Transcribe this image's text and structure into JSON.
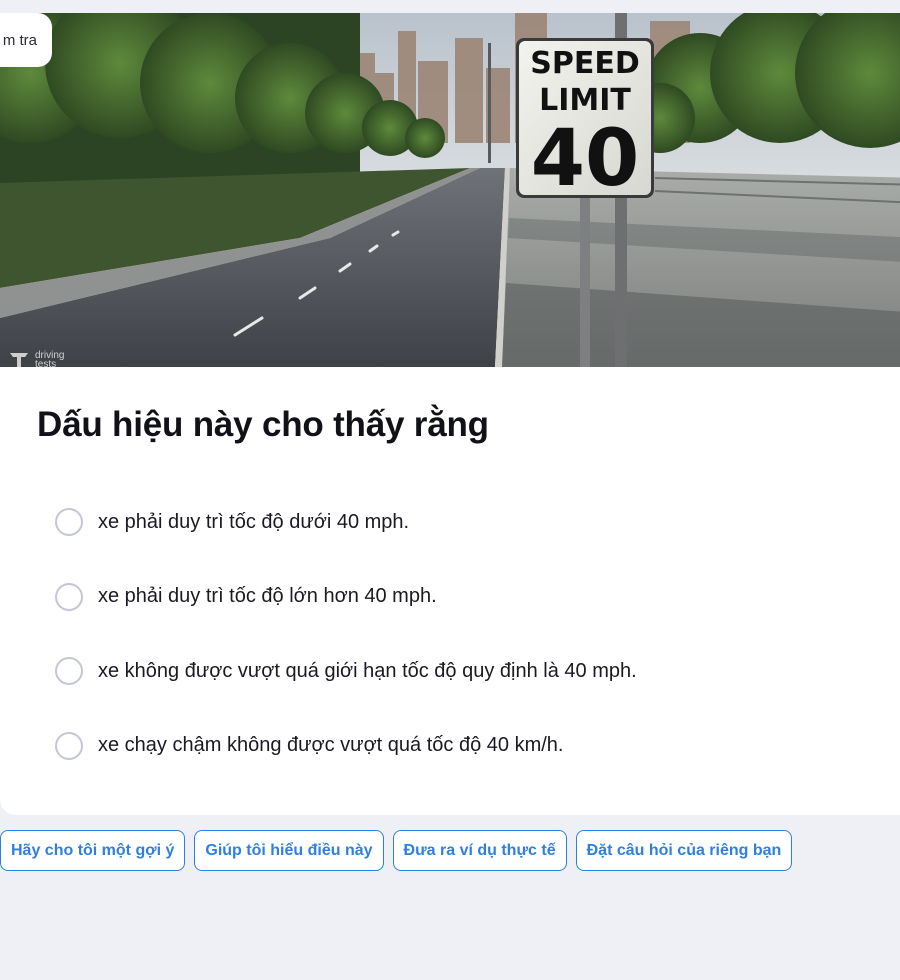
{
  "back_chip": {
    "label": "m tra"
  },
  "photo": {
    "description_icon": "speed-limit-road-photo",
    "sign": {
      "line1": "SPEED",
      "line2": "LIMIT",
      "number": "40"
    },
    "watermark": {
      "line1": "driving",
      "line2": "tests"
    }
  },
  "question": {
    "text": "Dấu hiệu này cho thấy rằng",
    "options": [
      {
        "label": "xe phải duy trì tốc độ dưới 40 mph."
      },
      {
        "label": "xe phải duy trì tốc độ lớn hơn 40 mph."
      },
      {
        "label": "xe không được vượt quá giới hạn tốc độ quy định là 40 mph."
      },
      {
        "label": "xe chạy chậm không được vượt quá tốc độ 40 km/h."
      }
    ]
  },
  "suggestions": [
    {
      "label": "Hãy cho tôi một gợi ý"
    },
    {
      "label": "Giúp tôi hiểu điều này"
    },
    {
      "label": "Đưa ra ví dụ thực tế"
    },
    {
      "label": "Đặt câu hỏi của riêng bạn"
    }
  ],
  "colors": {
    "accent": "#2f7fe3",
    "page_bg": "#eff0f6",
    "card_bg": "#ffffff",
    "radio_border": "#c5c6d4"
  }
}
